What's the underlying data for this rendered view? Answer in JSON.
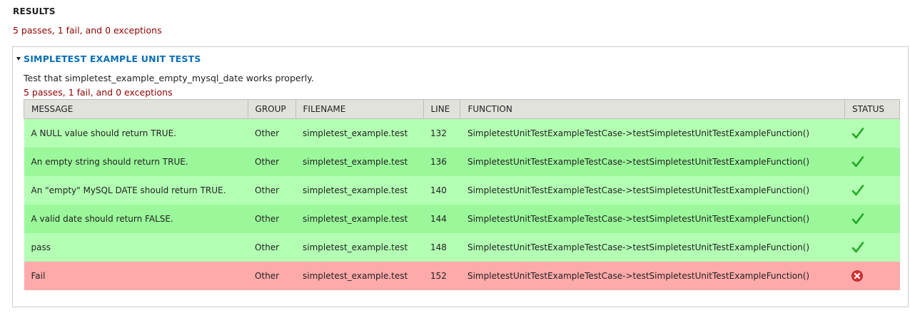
{
  "results": {
    "title": "RESULTS",
    "summary": "5 passes, 1 fail, and 0 exceptions"
  },
  "group": {
    "legend": "SIMPLETEST EXAMPLE UNIT TESTS",
    "description": "Test that simpletest_example_empty_mysql_date works properly.",
    "summary": "5 passes, 1 fail, and 0 exceptions"
  },
  "table": {
    "columns": [
      "MESSAGE",
      "GROUP",
      "FILENAME",
      "LINE",
      "FUNCTION",
      "STATUS"
    ],
    "rows": [
      {
        "message": "A NULL value should return TRUE.",
        "group": "Other",
        "filename": "simpletest_example.test",
        "line": "132",
        "function": "SimpletestUnitTestExampleTestCase->testSimpletestUnitTestExampleFunction()",
        "status": "pass"
      },
      {
        "message": "An empty string should return TRUE.",
        "group": "Other",
        "filename": "simpletest_example.test",
        "line": "136",
        "function": "SimpletestUnitTestExampleTestCase->testSimpletestUnitTestExampleFunction()",
        "status": "pass"
      },
      {
        "message": "An \"empty\" MySQL DATE should return TRUE.",
        "group": "Other",
        "filename": "simpletest_example.test",
        "line": "140",
        "function": "SimpletestUnitTestExampleTestCase->testSimpletestUnitTestExampleFunction()",
        "status": "pass"
      },
      {
        "message": "A valid date should return FALSE.",
        "group": "Other",
        "filename": "simpletest_example.test",
        "line": "144",
        "function": "SimpletestUnitTestExampleTestCase->testSimpletestUnitTestExampleFunction()",
        "status": "pass"
      },
      {
        "message": "pass",
        "group": "Other",
        "filename": "simpletest_example.test",
        "line": "148",
        "function": "SimpletestUnitTestExampleTestCase->testSimpletestUnitTestExampleFunction()",
        "status": "pass"
      },
      {
        "message": "Fail",
        "group": "Other",
        "filename": "simpletest_example.test",
        "line": "152",
        "function": "SimpletestUnitTestExampleTestCase->testSimpletestUnitTestExampleFunction()",
        "status": "fail"
      }
    ]
  },
  "colors": {
    "link": "#0a6eb4",
    "summary_text": "#8c0000",
    "pass_row_light": "#b3ffb3",
    "pass_row_dark": "#9af89a",
    "fail_row": "#ffaaaa",
    "check_icon": "#22a822",
    "fail_icon": "#d63232"
  },
  "icons": {
    "pass": "checkmark-icon",
    "fail": "error-x-icon",
    "collapse": "collapse-arrow-icon"
  }
}
